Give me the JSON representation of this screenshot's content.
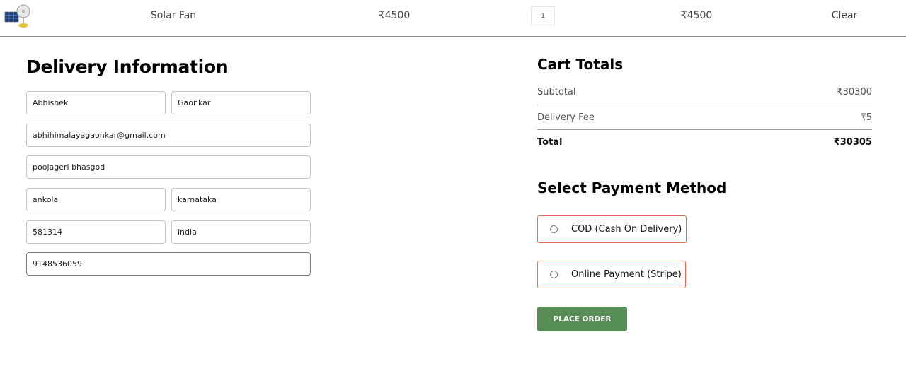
{
  "cart_item": {
    "image_icon": "solar-fan-product-image",
    "name": "Solar Fan",
    "price": "₹4500",
    "quantity": "1",
    "total": "₹4500",
    "clear_label": "Clear"
  },
  "delivery": {
    "title": "Delivery Information",
    "first_name": "Abhishek",
    "last_name": "Gaonkar",
    "email": "abhihimalayagaonkar@gmail.com",
    "street": "poojageri bhasgod",
    "city": "ankola",
    "state": "karnataka",
    "zip": "581314",
    "country": "india",
    "phone": "9148536059"
  },
  "cart_totals": {
    "title": "Cart Totals",
    "subtotal_label": "Subtotal",
    "subtotal_value": "₹30300",
    "delivery_fee_label": "Delivery Fee",
    "delivery_fee_value": "₹5",
    "total_label": "Total",
    "total_value": "₹30305"
  },
  "payment": {
    "title": "Select Payment Method",
    "options": [
      {
        "label": "COD (Cash On Delivery)"
      },
      {
        "label": "Online Payment (Stripe)"
      }
    ]
  },
  "place_order_label": "PLACE ORDER",
  "colors": {
    "accent_border": "#e5694a",
    "button_green": "#568e55"
  }
}
